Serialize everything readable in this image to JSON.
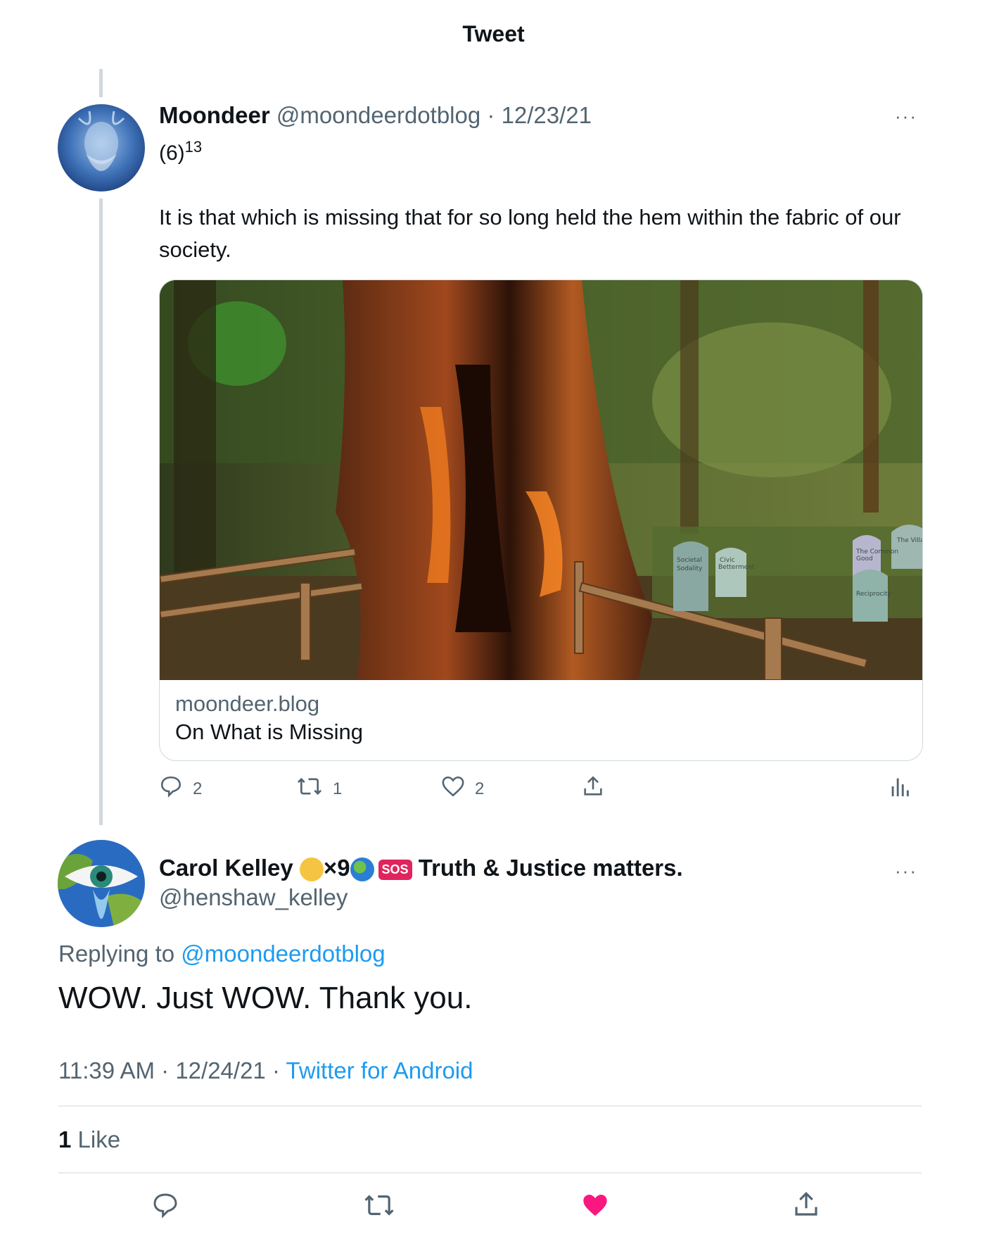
{
  "header": {
    "title": "Tweet"
  },
  "parent_tweet": {
    "name": "Moondeer",
    "handle": "@moondeerdotblog",
    "separator": "·",
    "date": "12/23/21",
    "more_label": "···",
    "line1_base": "(6)",
    "line1_sup": "13",
    "text": "It is that which is missing that for so long held the hem within the fabric of our society.",
    "card": {
      "domain": "moondeer.blog",
      "title": "On What is Missing",
      "image_labels": [
        "Societal Sodality",
        "Civic Betterment",
        "The Common Good",
        "Reciprocity",
        "The Village"
      ]
    },
    "actions": {
      "replies": "2",
      "retweets": "1",
      "likes": "2"
    }
  },
  "reply_tweet": {
    "name": "Carol Kelley",
    "name_suffix": "×9",
    "name_tail": "Truth & Justice matters.",
    "sos_label": "SOS",
    "handle": "@henshaw_kelley",
    "more_label": "···",
    "replying_prefix": "Replying to",
    "replying_handle": "@moondeerdotblog",
    "text": "WOW. Just WOW. Thank you.",
    "time": "11:39 AM",
    "date": "12/24/21",
    "separator": "·",
    "source": "Twitter for Android",
    "likes_count": "1",
    "likes_label": "Like"
  },
  "colors": {
    "accent": "#1d9bf0",
    "like": "#f91880",
    "muted": "#536471",
    "text": "#0f1419"
  }
}
